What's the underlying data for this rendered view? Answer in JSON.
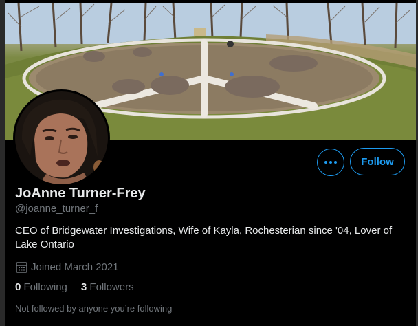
{
  "profile": {
    "name": "JoAnne Turner-Frey",
    "handle": "@joanne_turner_f",
    "bio": "CEO of Bridgewater Investigations, Wife of Kayla, Rochesterian since '04, Lover of Lake Ontario",
    "joined": "Joined March 2021",
    "following_count": "0",
    "following_label": "Following",
    "followers_count": "3",
    "followers_label": "Followers",
    "not_followed_note": "Not followed by anyone you’re following"
  },
  "actions": {
    "follow_label": "Follow",
    "more_icon": "more-options-icon"
  },
  "icons": {
    "joined": "calendar-icon"
  },
  "colors": {
    "accent": "#1d9bf0",
    "background": "#000000",
    "primary_text": "#e7e9ea",
    "secondary_text": "#71767b"
  }
}
